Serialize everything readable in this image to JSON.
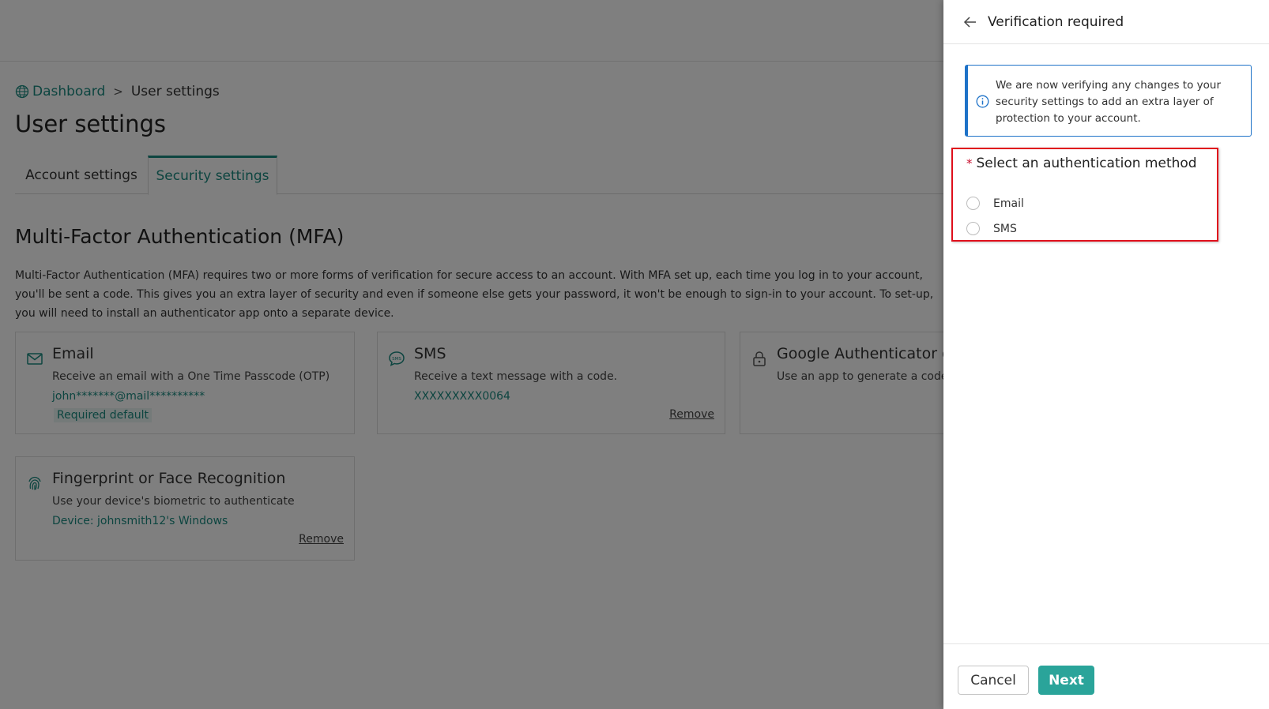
{
  "breadcrumb": {
    "home_label": "Dashboard",
    "separator": ">",
    "current": "User settings"
  },
  "page": {
    "title": "User settings"
  },
  "tabs": [
    {
      "label": "Account settings",
      "active": false
    },
    {
      "label": "Security settings",
      "active": true
    }
  ],
  "mfa": {
    "title": "Multi-Factor Authentication (MFA)",
    "description": "Multi-Factor Authentication (MFA) requires two or more forms of verification for secure access to an account. With MFA set up, each time you log in to your account, you'll be sent a code. This gives you an extra layer of security and even if someone else gets your password, it won't be enough to sign-in to your account. To set-up, you will need to install an authenticator app onto a separate device.",
    "cards": {
      "email": {
        "icon": "mail-icon",
        "title": "Email",
        "description": "Receive an email with a One Time Passcode (OTP)",
        "value": "john*******@mail**********",
        "badge": "Required default"
      },
      "sms": {
        "icon": "sms-icon",
        "title": "SMS",
        "description": "Receive a text message with a code.",
        "value": "XXXXXXXXX0064",
        "action": "Remove"
      },
      "google": {
        "icon": "lock-icon",
        "title": "Google Authenticator or",
        "description": "Use an app to generate a code"
      },
      "biometric": {
        "icon": "fingerprint-icon",
        "title": "Fingerprint or Face Recognition",
        "description": "Use your device's biometric to authenticate",
        "value": "Device: johnsmith12's Windows",
        "action": "Remove"
      }
    }
  },
  "drawer": {
    "title": "Verification required",
    "info_text": "We are now verifying any changes to your security settings to add an extra layer of protection to your account.",
    "method_label": "Select an authentication method",
    "required_mark": "*",
    "options": [
      {
        "label": "Email",
        "selected": false
      },
      {
        "label": "SMS",
        "selected": false
      }
    ],
    "cancel_label": "Cancel",
    "next_label": "Next"
  },
  "colors": {
    "accent": "#1a8a80",
    "primary_button": "#2aa49a",
    "info_border": "#1e72c8",
    "highlight": "#e0101c",
    "required": "#c8102e"
  }
}
